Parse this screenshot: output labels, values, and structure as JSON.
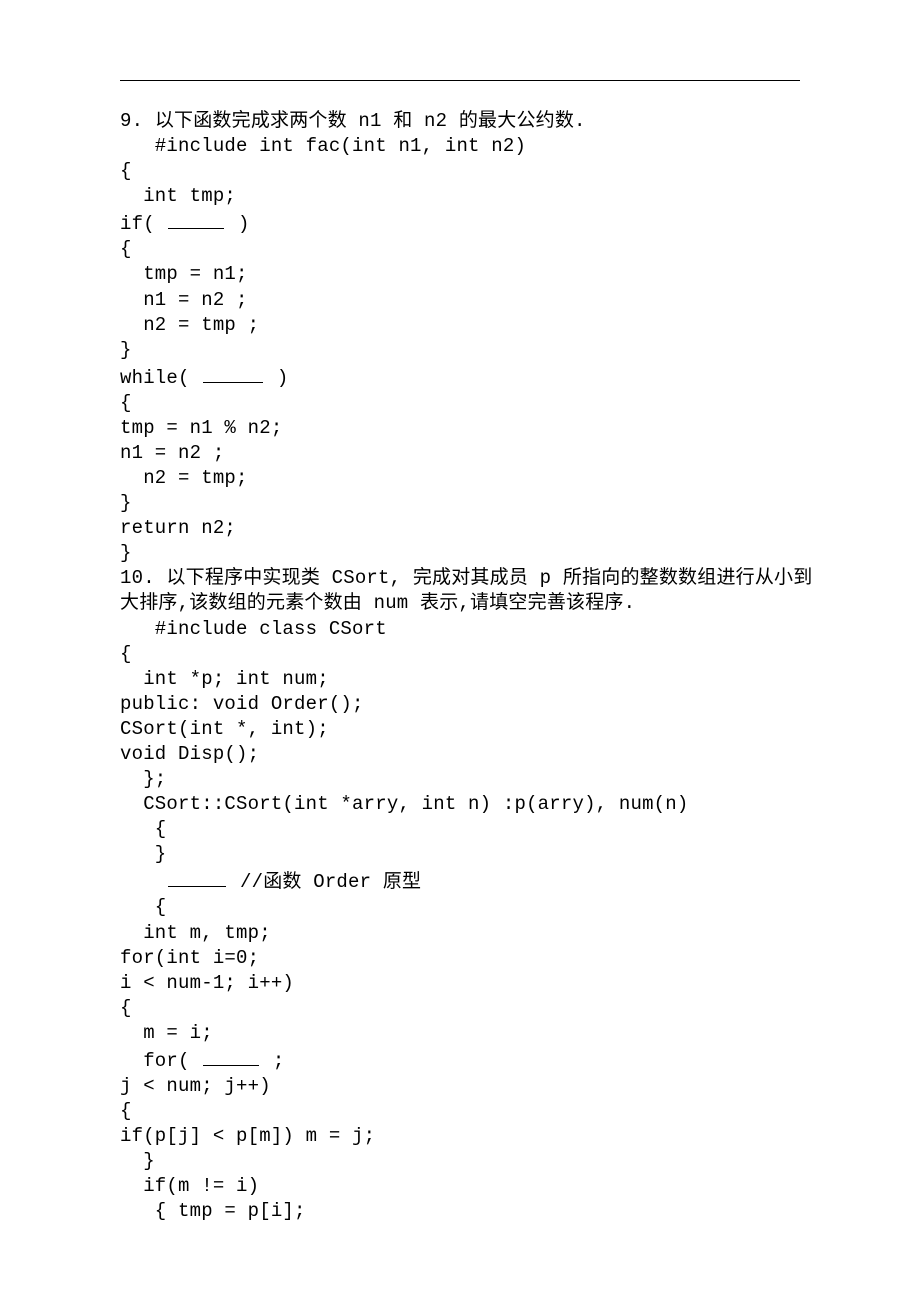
{
  "q9": {
    "num": "9.",
    "title": "以下函数完成求两个数 n1 和 n2 的最大公约数.",
    "lines": [
      "   #include int fac(int n1, int n2)",
      "{",
      "  int tmp;",
      "if( ",
      " )",
      "{",
      "  tmp = n1;",
      "  n1 = n2 ;",
      "  n2 = tmp ;",
      "}",
      "while( ",
      " )",
      "{",
      "tmp = n1 % n2;",
      "n1 = n2 ;",
      "  n2 = tmp;",
      "}",
      "return n2;",
      "}"
    ]
  },
  "q10": {
    "num": "10.",
    "title_a": "以下程序中实现类 CSort, 完成对其成员 p 所指向的整数数组进行从小到",
    "title_b": "大排序,该数组的元素个数由 num 表示,请填空完善该程序.",
    "lines": [
      "   #include class CSort",
      "{",
      "  int *p; int num;",
      "public: void Order();",
      "CSort(int *, int);",
      "void Disp();",
      "  };",
      "  CSort::CSort(int *arry, int n) :p(arry), num(n)",
      "   {",
      "   }",
      "    ",
      " //函数 Order 原型",
      "   {",
      "  int m, tmp;",
      "for(int i=0;",
      "i < num-1; i++)",
      "{",
      "  m = i;",
      "  for( ",
      " ;",
      "j < num; j++)",
      "{",
      "if(p[j] < p[m]) m = j;",
      "  }",
      "  if(m != i)",
      "   { tmp = p[i];"
    ]
  }
}
